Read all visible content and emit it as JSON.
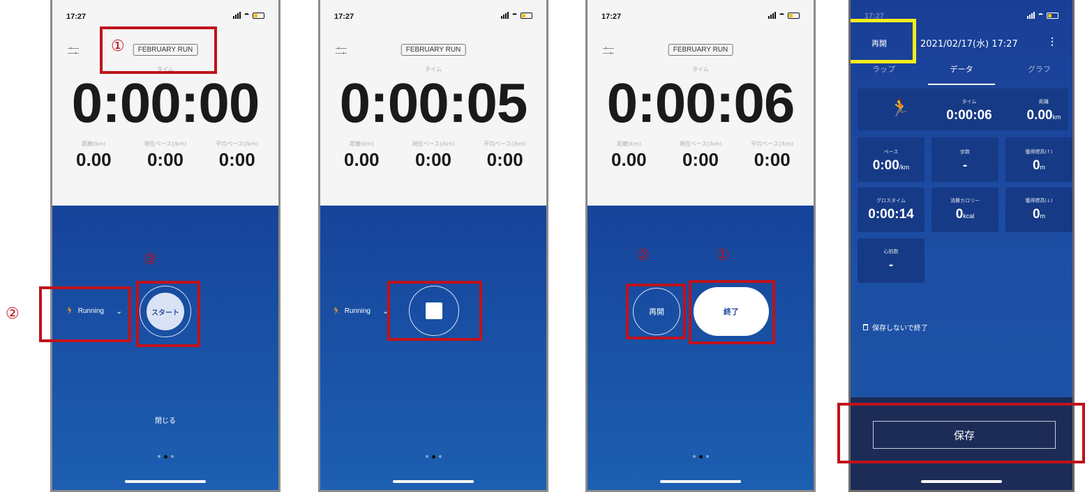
{
  "status_time": "17:27",
  "run_name": "FEBRUARY RUN",
  "time_label": "タイム",
  "stat_labels": {
    "distance": "距離(km)",
    "current_pace": "現在ペース(/km)",
    "avg_pace": "平均ペース(/km)"
  },
  "stat_values": {
    "distance": "0.00",
    "current_pace": "0:00",
    "avg_pace": "0:00"
  },
  "activity": "Running",
  "screens": [
    {
      "elapsed": "0:00:00",
      "start_label": "スタート",
      "close_label": "閉じる"
    },
    {
      "elapsed": "0:00:05"
    },
    {
      "elapsed": "0:00:06",
      "resume_label": "再開",
      "end_label": "終了"
    }
  ],
  "markers": {
    "circled_1": "①",
    "circled_2": "②",
    "circled_3": "③"
  },
  "summary": {
    "resume_label": "再開",
    "datetime": "2021/02/17(水) 17:27",
    "menu_icon": "⋮",
    "tabs": [
      "ラップ",
      "データ",
      "グラフ"
    ],
    "active_tab": "データ",
    "time": {
      "label": "タイム",
      "value": "0:00:06"
    },
    "distance": {
      "label": "距離",
      "value": "0.00",
      "unit": "km"
    },
    "pace": {
      "label": "ペース",
      "value": "0:00",
      "unit": "/km"
    },
    "steps": {
      "label": "歩数",
      "value": "-"
    },
    "elev_up": {
      "label": "獲得標高(↑)",
      "value": "0",
      "unit": "m"
    },
    "gross_time": {
      "label": "グロスタイム",
      "value": "0:00:14"
    },
    "calories": {
      "label": "消費カロリー",
      "value": "0",
      "unit": "kcal"
    },
    "elev_down": {
      "label": "獲得標高(↓)",
      "value": "0",
      "unit": "m"
    },
    "heart_rate": {
      "label": "心拍数",
      "value": "-"
    },
    "discard_label": "保存しないで終了",
    "save_label": "保存"
  },
  "colors": {
    "highlight_red": "#c0121b",
    "highlight_yellow": "#f6ee1a",
    "run_blue": "#1a54a8"
  }
}
